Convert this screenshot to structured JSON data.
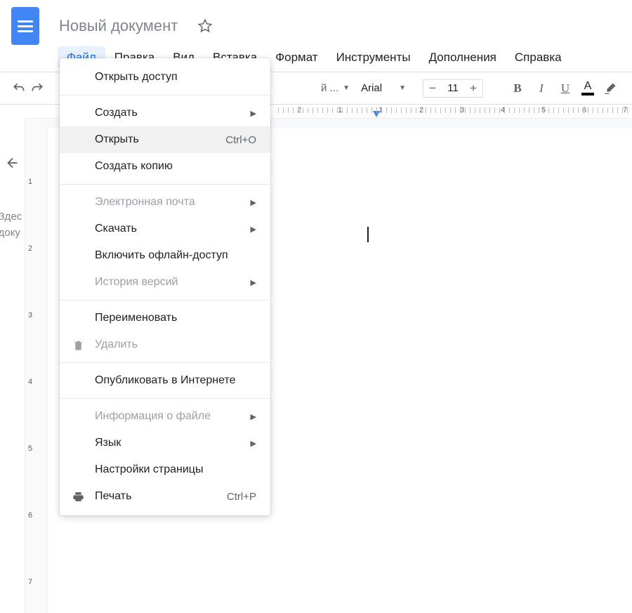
{
  "doc_title": "Новый документ",
  "menubar": [
    "Файл",
    "Правка",
    "Вид",
    "Вставка",
    "Формат",
    "Инструменты",
    "Дополнения",
    "Справка"
  ],
  "menubar_active_index": 0,
  "toolbar": {
    "partial_label": "й ...",
    "font_name": "Arial",
    "font_size": "11"
  },
  "outline": {
    "line1": "Здес",
    "line2": "доку"
  },
  "ruler_h_labels": [
    "2",
    "1",
    "1",
    "2",
    "3",
    "4",
    "5",
    "6",
    "7"
  ],
  "ruler_v_labels": [
    "1",
    "2",
    "3",
    "4",
    "5",
    "6",
    "7"
  ],
  "file_menu": [
    {
      "label": "Открыть доступ",
      "type": "item"
    },
    {
      "type": "sep"
    },
    {
      "label": "Создать",
      "type": "submenu"
    },
    {
      "label": "Открыть",
      "type": "item",
      "shortcut": "Ctrl+O",
      "hover": true
    },
    {
      "label": "Создать копию",
      "type": "item"
    },
    {
      "type": "sep"
    },
    {
      "label": "Электронная почта",
      "type": "submenu",
      "disabled": true
    },
    {
      "label": "Скачать",
      "type": "submenu"
    },
    {
      "label": "Включить офлайн-доступ",
      "type": "item"
    },
    {
      "label": "История версий",
      "type": "submenu",
      "disabled": true
    },
    {
      "type": "sep"
    },
    {
      "label": "Переименовать",
      "type": "item"
    },
    {
      "label": "Удалить",
      "type": "item",
      "disabled": true,
      "icon": "trash"
    },
    {
      "type": "sep"
    },
    {
      "label": "Опубликовать в Интернете",
      "type": "item"
    },
    {
      "type": "sep"
    },
    {
      "label": "Информация о файле",
      "type": "submenu",
      "disabled": true
    },
    {
      "label": "Язык",
      "type": "submenu"
    },
    {
      "label": "Настройки страницы",
      "type": "item"
    },
    {
      "label": "Печать",
      "type": "item",
      "shortcut": "Ctrl+P",
      "icon": "print"
    }
  ]
}
